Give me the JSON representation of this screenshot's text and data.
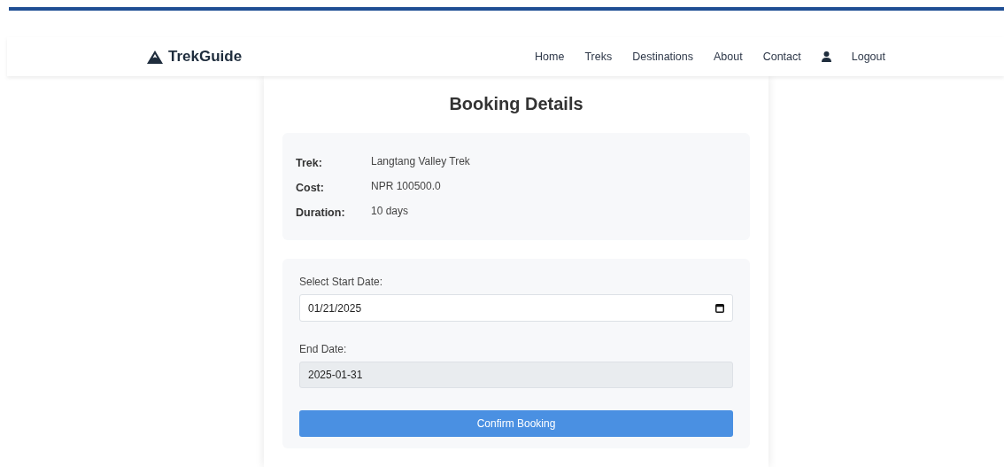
{
  "brand": {
    "name": "TrekGuide"
  },
  "nav": [
    {
      "kind": "link",
      "label": "Home"
    },
    {
      "kind": "link",
      "label": "Treks"
    },
    {
      "kind": "link",
      "label": "Destinations"
    },
    {
      "kind": "link",
      "label": "About"
    },
    {
      "kind": "link",
      "label": "Contact"
    },
    {
      "kind": "user"
    },
    {
      "kind": "link",
      "label": "Logout"
    }
  ],
  "title": "Booking Details",
  "details": [
    {
      "label": "Trek:",
      "value": "Langtang Valley Trek"
    },
    {
      "label": "Cost:",
      "value": "NPR 100500.0"
    },
    {
      "label": "Duration:",
      "value": "10 days"
    }
  ],
  "form": {
    "fields": [
      {
        "kind": "date",
        "label": "Select Start Date:",
        "value": "01/21/2025",
        "readonly": false
      },
      {
        "kind": "text",
        "label": "End Date:",
        "value": "2025-01-31",
        "readonly": true
      }
    ],
    "submit": "Confirm Booking"
  }
}
